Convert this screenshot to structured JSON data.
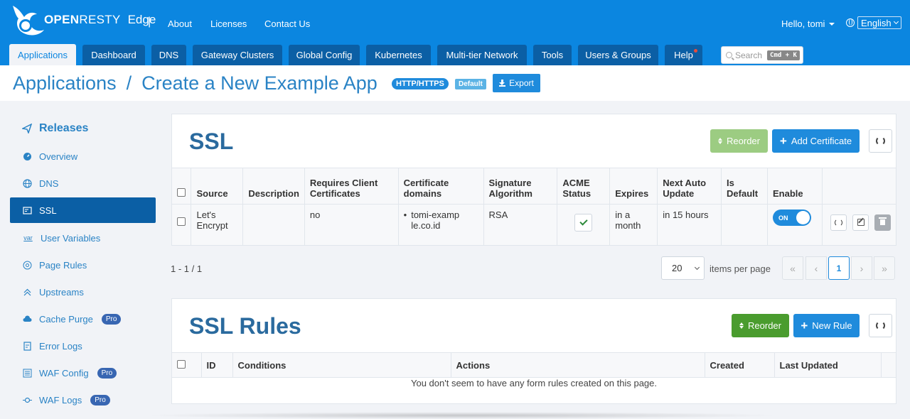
{
  "header": {
    "brand_main": "OPEN",
    "brand_rest": "RESTY",
    "brand_product": "Edge",
    "separator": "|",
    "links": {
      "about": "About",
      "licenses": "Licenses",
      "contact": "Contact Us"
    },
    "user_greeting": "Hello, tomi",
    "language": "English",
    "search_placeholder": "Search",
    "search_shortcut": "Cmd + K"
  },
  "nav_tabs": {
    "applications": "Applications",
    "dashboard": "Dashboard",
    "dns": "DNS",
    "gateway_clusters": "Gateway Clusters",
    "global_config": "Global Config",
    "kubernetes": "Kubernetes",
    "multi_tier": "Multi-tier Network",
    "tools": "Tools",
    "users_groups": "Users & Groups",
    "help": "Help",
    "active": "Applications"
  },
  "breadcrumb": {
    "root": "Applications",
    "separator": "/",
    "current": "Create a New Example App",
    "protocol_badge": "HTTP/HTTPS",
    "default_badge": "Default",
    "export_label": "Export"
  },
  "sidebar": {
    "title": "Releases",
    "items": {
      "overview": "Overview",
      "dns": "DNS",
      "ssl": "SSL",
      "user_variables": "User Variables",
      "page_rules": "Page Rules",
      "upstreams": "Upstreams",
      "cache_purge": "Cache Purge",
      "error_logs": "Error Logs",
      "waf_config": "WAF Config",
      "waf_logs": "WAF Logs"
    },
    "pro_label": "Pro",
    "var_icon_text": "var",
    "active": "SSL"
  },
  "ssl": {
    "title": "SSL",
    "reorder_label": "Reorder",
    "add_label": "Add Certificate",
    "columns": {
      "source": "Source",
      "description": "Description",
      "requires_client": "Requires Client Certificates",
      "domains": "Certificate domains",
      "algorithm": "Signature Algorithm",
      "acme": "ACME Status",
      "expires": "Expires",
      "next_update": "Next Auto Update",
      "is_default": "Is Default",
      "enable": "Enable"
    },
    "rows": [
      {
        "source": "Let's Encrypt",
        "description": "",
        "requires_client": "no",
        "domain": "tomi-example.co.id",
        "algorithm": "RSA",
        "acme_ok": true,
        "expires": "in a month",
        "next_update": "in 15 hours",
        "is_default": "",
        "enable_label": "ON",
        "enabled": true
      }
    ],
    "pagination": {
      "range": "1 - 1 / 1",
      "per_page": "20",
      "per_page_label": "items per page",
      "current_page": "1"
    }
  },
  "ssl_rules": {
    "title": "SSL Rules",
    "reorder_label": "Reorder",
    "new_label": "New Rule",
    "columns": {
      "id": "ID",
      "conditions": "Conditions",
      "actions": "Actions",
      "created": "Created",
      "last_updated": "Last Updated"
    },
    "empty_message": "You don't seem to have any form rules created on this page."
  },
  "colors": {
    "topbar": "#0b86e0",
    "tab": "#0b5fa5",
    "accent": "#1f8bdc",
    "reorder_green": "#4a9c2e",
    "pro_badge": "#3866b2"
  }
}
